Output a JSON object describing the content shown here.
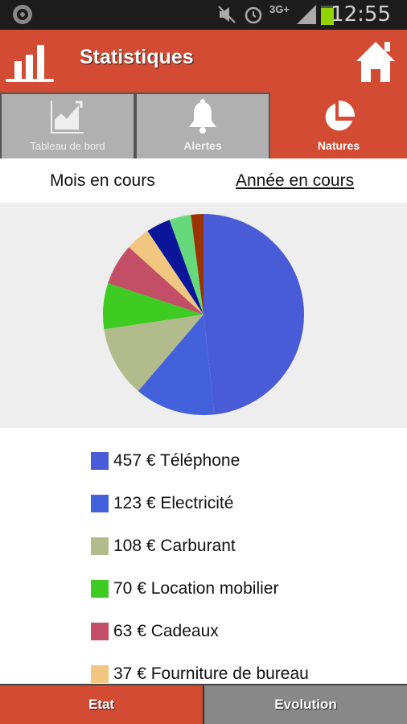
{
  "status_bar": {
    "time": "12:55",
    "network": "3G+",
    "battery_color": "#8fd400"
  },
  "header": {
    "title": "Statistiques",
    "accent": "#d44b33"
  },
  "tabs": [
    {
      "label": "Tableau de bord",
      "icon": "chart-growth-icon",
      "active": false
    },
    {
      "label": "Alertes",
      "icon": "bell-icon",
      "active": false
    },
    {
      "label": "Natures",
      "icon": "pie-chart-icon",
      "active": true
    }
  ],
  "period": {
    "month": "Mois en cours",
    "year": "Année en cours",
    "selected": "Année en cours"
  },
  "legend": [
    {
      "text": "457 € Téléphone",
      "color": "#4a5bd8"
    },
    {
      "text": "123 € Electricité",
      "color": "#4461dc"
    },
    {
      "text": "108 € Carburant",
      "color": "#b1bb8b"
    },
    {
      "text": "70 € Location mobilier",
      "color": "#3fcc22"
    },
    {
      "text": "63 € Cadeaux",
      "color": "#c24f65"
    },
    {
      "text": "37 € Fourniture de bureau",
      "color": "#f1c681"
    }
  ],
  "chart_data": {
    "type": "pie",
    "unit": "€",
    "slices": [
      {
        "label": "Téléphone",
        "value": 457,
        "color": "#4a5bd8"
      },
      {
        "label": "Electricité",
        "value": 123,
        "color": "#4461dc"
      },
      {
        "label": "Carburant",
        "value": 108,
        "color": "#b1bb8b"
      },
      {
        "label": "Location mobilier",
        "value": 70,
        "color": "#3fcc22"
      },
      {
        "label": "Cadeaux",
        "value": 63,
        "color": "#c24f65"
      },
      {
        "label": "Fourniture de bureau",
        "value": 37,
        "color": "#f1c681"
      },
      {
        "value": 37,
        "color": "#0a159a"
      },
      {
        "value": 33,
        "color": "#67d97d"
      },
      {
        "value": 19,
        "color": "#9a3300"
      }
    ]
  },
  "bottom": {
    "etat": "Etat",
    "evolution": "Evolution"
  }
}
